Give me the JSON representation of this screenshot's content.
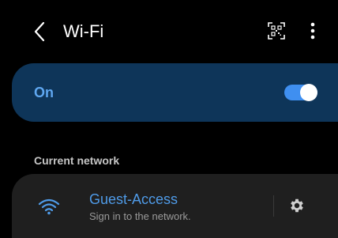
{
  "appbar": {
    "title": "Wi-Fi",
    "back_icon": "chevron-left-icon",
    "qr_icon": "qr-code-scan-icon",
    "more_icon": "more-vertical-icon"
  },
  "wifi_toggle": {
    "label": "On",
    "state": "on"
  },
  "current_network": {
    "section_header": "Current network",
    "name": "Guest-Access",
    "status": "Sign in to the network.",
    "wifi_icon": "wifi-icon",
    "settings_icon": "gear-icon"
  },
  "colors": {
    "background": "#000000",
    "toggle_card": "#0e3559",
    "accent": "#4f9be8",
    "network_card": "#1f1f1f"
  }
}
